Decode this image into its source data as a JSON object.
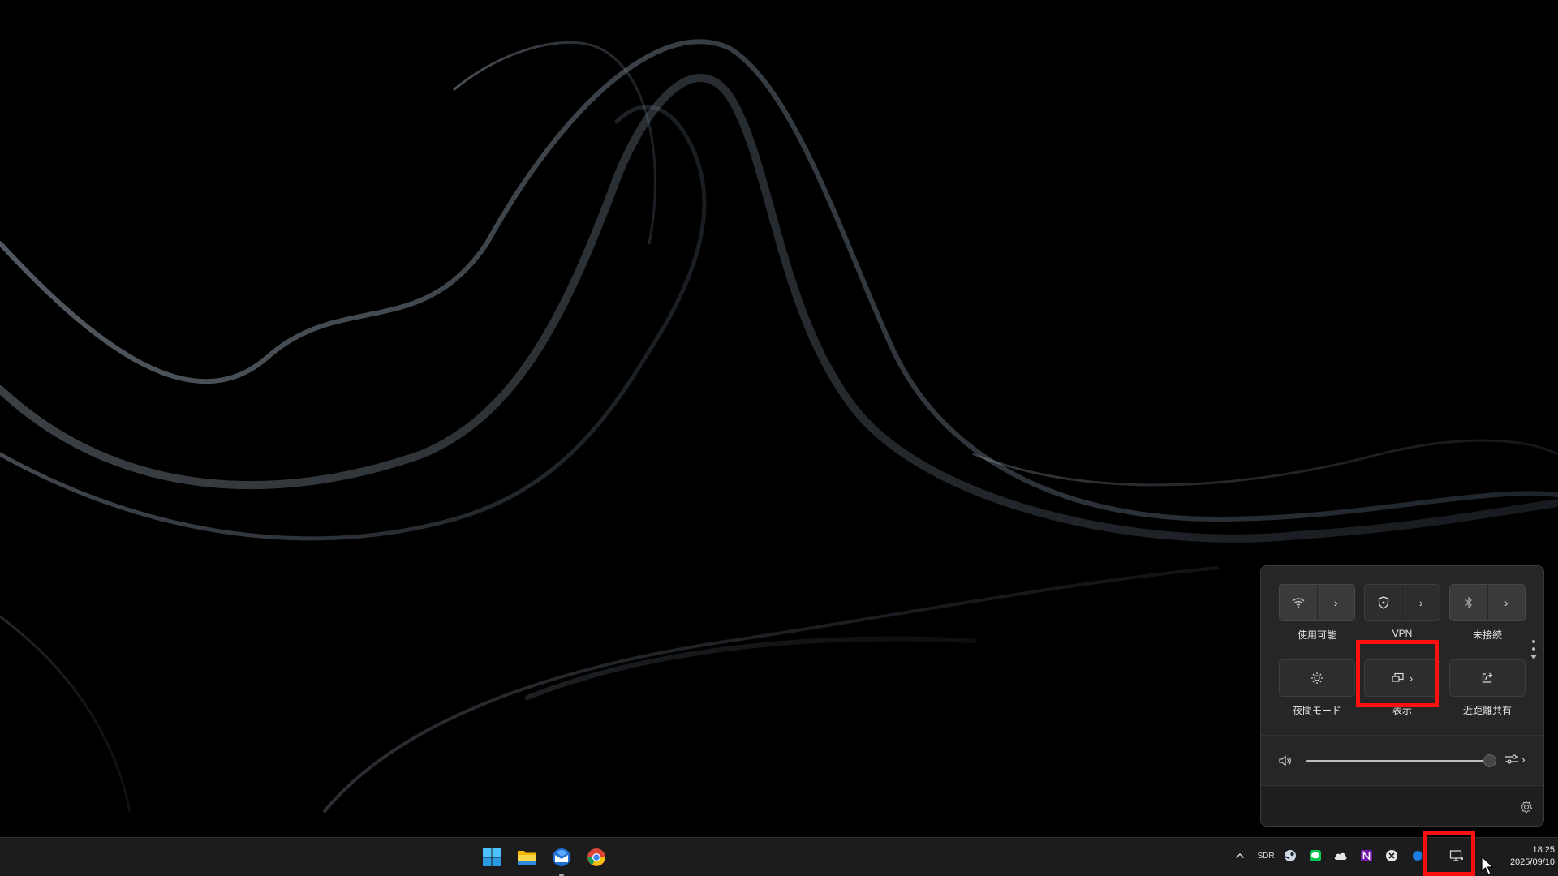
{
  "quick_settings": {
    "tiles_row1": [
      {
        "label": "使用可能",
        "icon": "wifi-icon"
      },
      {
        "label": "VPN",
        "icon": "shield-icon"
      },
      {
        "label": "未接続",
        "icon": "bluetooth-icon"
      }
    ],
    "tiles_row2": [
      {
        "label": "夜間モード",
        "icon": "brightness-icon"
      },
      {
        "label": "表示",
        "icon": "cast-display-icon"
      },
      {
        "label": "近距離共有",
        "icon": "share-icon"
      }
    ],
    "volume": {
      "level_percent": 100,
      "icon": "speaker-icon"
    },
    "settings_icon": "gear-icon"
  },
  "taskbar": {
    "apps": [
      "windows-start-icon",
      "file-explorer-icon",
      "thunderbird-icon",
      "chrome-icon"
    ],
    "tray": {
      "sdr_label": "SDR",
      "clock_time": "18:25",
      "clock_date": "2025/09/10"
    }
  },
  "colors": {
    "highlight": "#ff1010",
    "flyout_bg": "#262626",
    "taskbar_bg": "#1c1c1c"
  }
}
